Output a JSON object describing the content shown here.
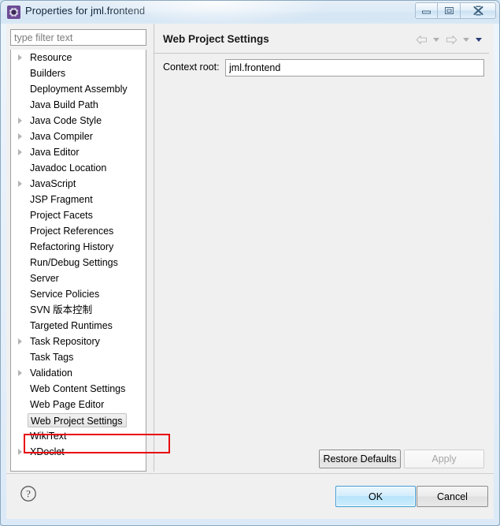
{
  "window": {
    "title": "Properties for jml.frontend",
    "icon": "gear-icon",
    "controls": {
      "minimize": "Minimize",
      "restore": "Restore",
      "close": "Close"
    }
  },
  "sidebar": {
    "filter": {
      "placeholder": "type filter text",
      "value": ""
    },
    "items": [
      {
        "label": "Resource",
        "expandable": true,
        "selected": false
      },
      {
        "label": "Builders",
        "expandable": false,
        "selected": false
      },
      {
        "label": "Deployment Assembly",
        "expandable": false,
        "selected": false
      },
      {
        "label": "Java Build Path",
        "expandable": false,
        "selected": false
      },
      {
        "label": "Java Code Style",
        "expandable": true,
        "selected": false
      },
      {
        "label": "Java Compiler",
        "expandable": true,
        "selected": false
      },
      {
        "label": "Java Editor",
        "expandable": true,
        "selected": false
      },
      {
        "label": "Javadoc Location",
        "expandable": false,
        "selected": false
      },
      {
        "label": "JavaScript",
        "expandable": true,
        "selected": false
      },
      {
        "label": "JSP Fragment",
        "expandable": false,
        "selected": false
      },
      {
        "label": "Project Facets",
        "expandable": false,
        "selected": false
      },
      {
        "label": "Project References",
        "expandable": false,
        "selected": false
      },
      {
        "label": "Refactoring History",
        "expandable": false,
        "selected": false
      },
      {
        "label": "Run/Debug Settings",
        "expandable": false,
        "selected": false
      },
      {
        "label": "Server",
        "expandable": false,
        "selected": false
      },
      {
        "label": "Service Policies",
        "expandable": false,
        "selected": false
      },
      {
        "label": "SVN 版本控制",
        "expandable": false,
        "selected": false
      },
      {
        "label": "Targeted Runtimes",
        "expandable": false,
        "selected": false
      },
      {
        "label": "Task Repository",
        "expandable": true,
        "selected": false
      },
      {
        "label": "Task Tags",
        "expandable": false,
        "selected": false
      },
      {
        "label": "Validation",
        "expandable": true,
        "selected": false
      },
      {
        "label": "Web Content Settings",
        "expandable": false,
        "selected": false
      },
      {
        "label": "Web Page Editor",
        "expandable": false,
        "selected": false
      },
      {
        "label": "Web Project Settings",
        "expandable": false,
        "selected": true
      },
      {
        "label": "WikiText",
        "expandable": false,
        "selected": false
      },
      {
        "label": "XDoclet",
        "expandable": true,
        "selected": false
      }
    ]
  },
  "main": {
    "title": "Web Project Settings",
    "nav": {
      "back_icon": "back-arrow-icon",
      "back_menu_icon": "chevron-down-icon",
      "forward_icon": "forward-arrow-icon",
      "forward_menu_icon": "chevron-down-icon",
      "view_menu_icon": "chevron-down-icon"
    },
    "fields": [
      {
        "label": "Context root:",
        "value": "jml.frontend",
        "placeholder": ""
      }
    ],
    "buttons": {
      "restore_defaults": "Restore Defaults",
      "apply": "Apply",
      "apply_enabled": false
    }
  },
  "footer": {
    "help_icon": "help-question-icon",
    "ok": "OK",
    "cancel": "Cancel"
  },
  "annotation": {
    "color": "#e8000a",
    "target": "Web Project Settings"
  }
}
